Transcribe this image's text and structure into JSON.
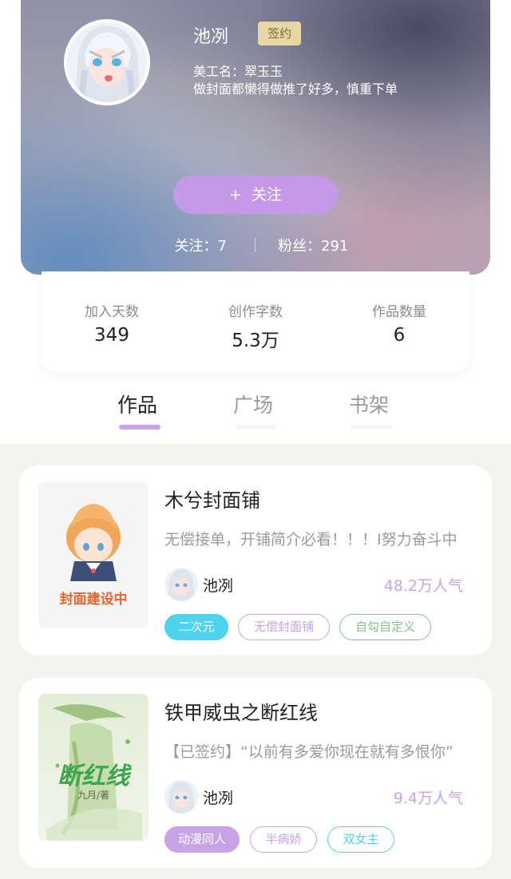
{
  "profile": {
    "name": "池冽",
    "badge": "签约",
    "artist_line": "美工名：翠玉玉",
    "bio": "做封面都懒得做推了好多，慎重下单",
    "follow_plus": "+",
    "follow_label": "关注",
    "following_text": "关注：7",
    "fans_text": "粉丝：291"
  },
  "stats": [
    {
      "label": "加入天数",
      "value": "349"
    },
    {
      "label": "创作字数",
      "value": "5.3万"
    },
    {
      "label": "作品数量",
      "value": "6"
    }
  ],
  "tabs": [
    "作品",
    "广场",
    "书架"
  ],
  "works": [
    {
      "title": "木兮封面铺",
      "desc": "无偿接单，开铺简介必看！！！I努力奋斗中",
      "author": "池冽",
      "popularity": "48.2万人气",
      "cover_text": "封面建设中",
      "tags": [
        "二次元",
        "无偿封面铺",
        "自勾自定义"
      ]
    },
    {
      "title": "铁甲威虫之断红线",
      "desc": "【已签约】“以前有多爱你现在就有多恨你”",
      "author": "池冽",
      "popularity": "9.4万人气",
      "cover_title": "断红线",
      "cover_author": "九月/著",
      "tags": [
        "动漫同人",
        "半病娇",
        "双女主"
      ]
    }
  ],
  "colors": {
    "accent": "#c598e8",
    "popularity": "#c9a3e8",
    "badge_bg": "#e8d7a4",
    "tag_cyan": "#4dd3ec",
    "tag_purple": "#c9a3e8",
    "tag_green": "#7cc68a"
  }
}
